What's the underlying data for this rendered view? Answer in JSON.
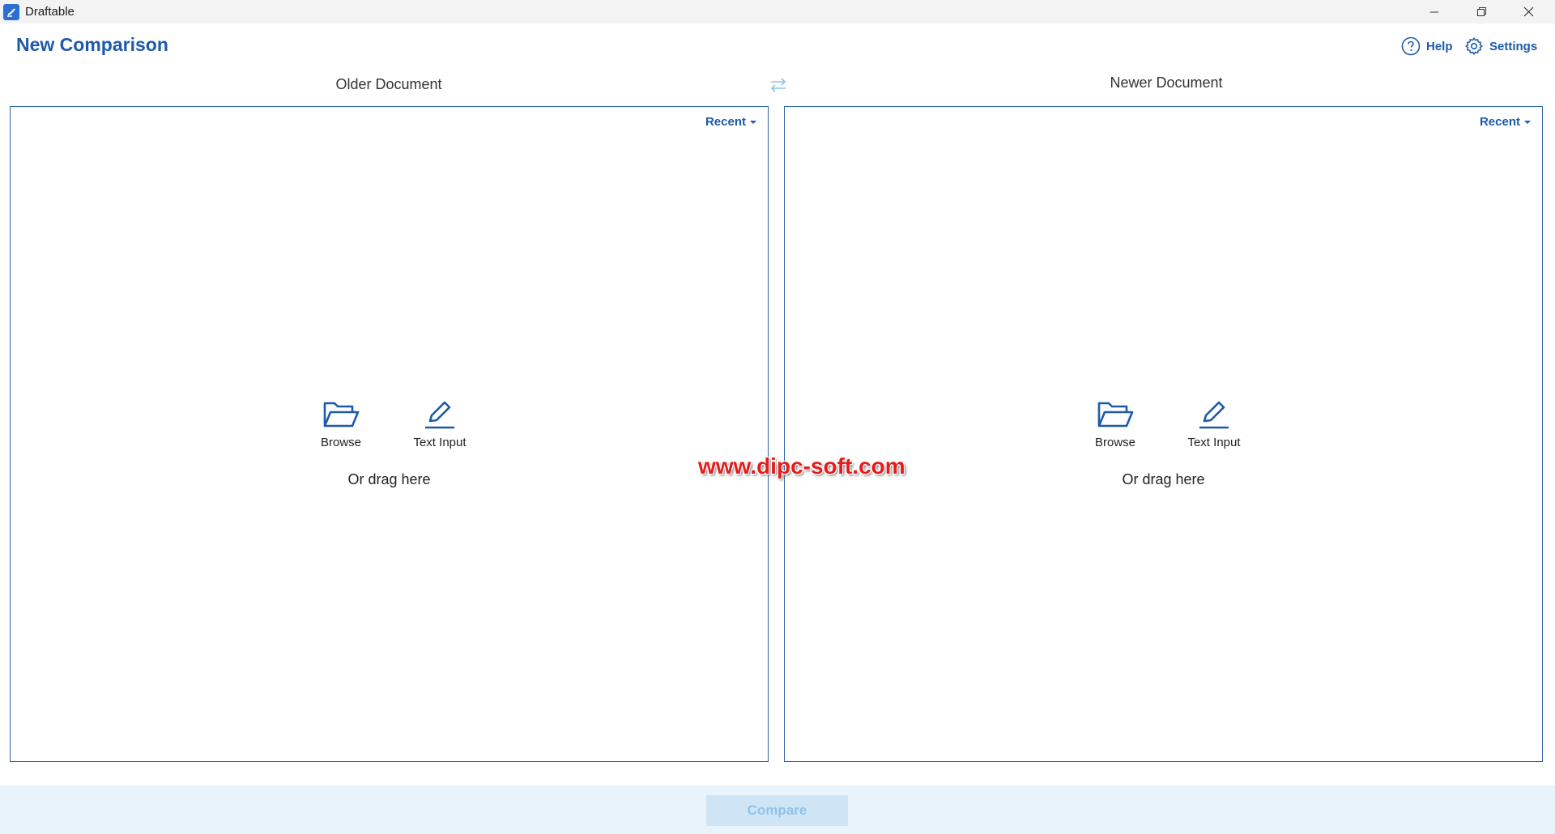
{
  "window": {
    "title": "Draftable",
    "minimize_icon": "minimize-icon",
    "restore_icon": "restore-icon",
    "close_icon": "close-icon"
  },
  "header": {
    "title": "New Comparison",
    "help_label": "Help",
    "settings_label": "Settings"
  },
  "swap_icon": "swap-arrows-icon",
  "older": {
    "title": "Older Document",
    "recent_label": "Recent",
    "browse_label": "Browse",
    "text_input_label": "Text Input",
    "drag_text": "Or drag here"
  },
  "newer": {
    "title": "Newer Document",
    "recent_label": "Recent",
    "browse_label": "Browse",
    "text_input_label": "Text Input",
    "drag_text": "Or drag here"
  },
  "watermark": "www.dipc-soft.com",
  "footer": {
    "compare_label": "Compare"
  },
  "colors": {
    "accent": "#1d5aa8",
    "panel_border": "#2c62a8",
    "footer_bg": "#e8f3fb",
    "compare_disabled": "#cfe5f6",
    "watermark": "#e11d1d"
  }
}
